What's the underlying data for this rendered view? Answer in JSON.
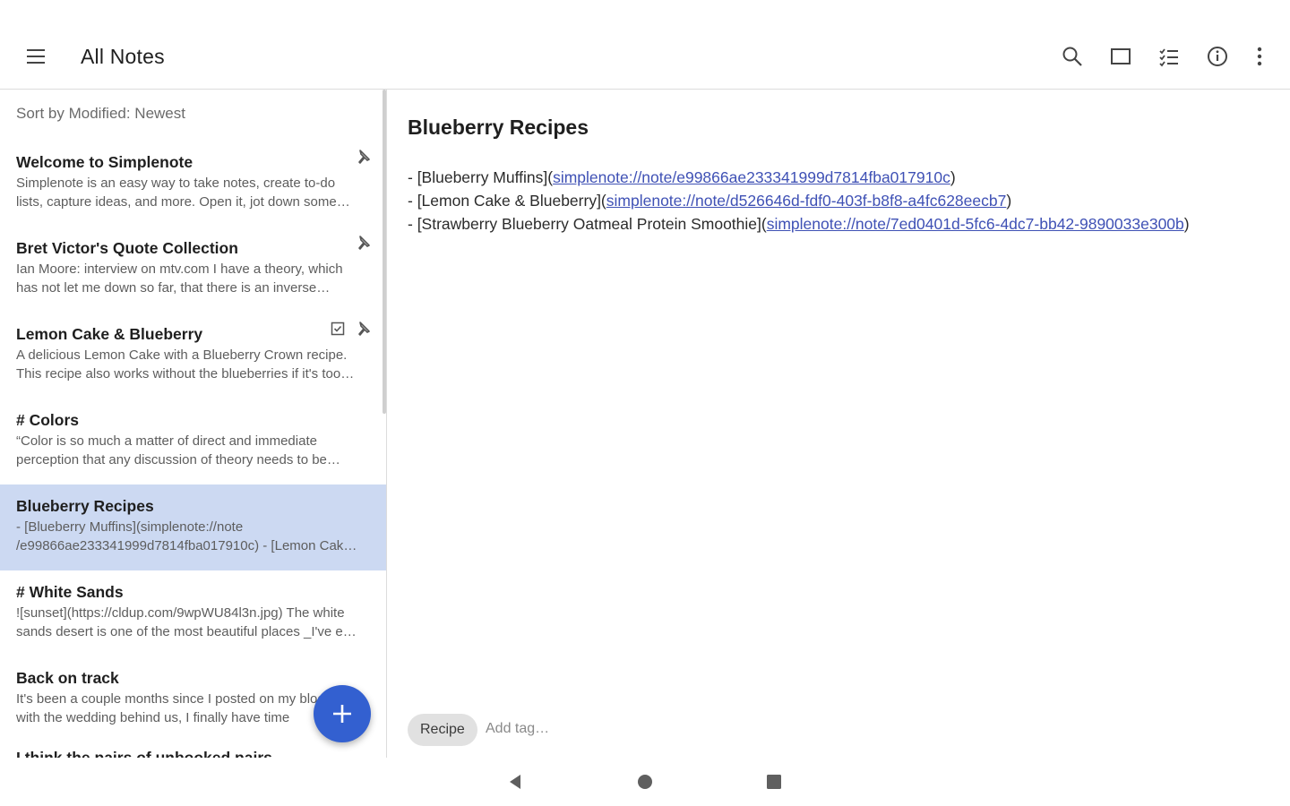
{
  "appbar": {
    "title": "All Notes",
    "icons": [
      "menu-icon",
      "search-icon",
      "sidebar-toggle-icon",
      "checklist-icon",
      "info-icon",
      "more-vert-icon"
    ]
  },
  "list": {
    "sort_prefix": "Sort by ",
    "sort_value": "Modified: Newest",
    "notes": [
      {
        "title": "Welcome to Simplenote",
        "preview": "Simplenote is an easy way to take notes, create to-do lists, capture ideas, and more. Open it, jot down some thoughts, and you're done.",
        "pinned": true,
        "checklist": false
      },
      {
        "title": "Bret Victor's Quote Collection",
        "preview": "Ian Moore: interview on mtv.com I have a theory, which has not let me down so far, that there is an inverse relationship",
        "pinned": true,
        "checklist": false
      },
      {
        "title": "Lemon Cake & Blueberry",
        "preview": "A delicious Lemon Cake with a Blueberry Crown recipe. This recipe also works without the blueberries if it's too much",
        "pinned": true,
        "checklist": true
      },
      {
        "title": "# Colors",
        "preview": "“Color is so much a matter of direct and immediate perception that any discussion of theory needs to be accompanied",
        "pinned": false,
        "checklist": false
      },
      {
        "title": "Blueberry Recipes",
        "preview": "- [Blueberry Muffins](simplenote://note /e99866ae233341999d7814fba017910c) - [Lemon Cake & Blueberry]",
        "pinned": false,
        "checklist": false,
        "selected": true
      },
      {
        "title": "# White Sands",
        "preview": "![sunset](https://cldup.com/9wpWU84l3n.jpg) The white sands desert is one of the most beautiful places _I've ever been",
        "pinned": false,
        "checklist": false
      },
      {
        "title": "Back on track",
        "preview": "It's been a couple months since I posted on my blog. But with the wedding behind us, I finally have time",
        "pinned": false,
        "checklist": false
      }
    ],
    "partial_title": "I think the pairs of unbooked pairs"
  },
  "editor": {
    "title": "Blueberry Recipes",
    "lines": [
      {
        "prefix": "- [Blueberry Muffins](",
        "link": "simplenote://note/e99866ae233341999d7814fba017910c",
        "suffix": ")"
      },
      {
        "prefix": "- [Lemon Cake & Blueberry](",
        "link": "simplenote://note/d526646d-fdf0-403f-b8f8-a4fc628eecb7",
        "suffix": ")"
      },
      {
        "prefix": "- [Strawberry Blueberry Oatmeal Protein Smoothie](",
        "link": "simplenote://note/7ed0401d-5fc6-4dc7-bb42-9890033e300b",
        "suffix": ")"
      }
    ],
    "tag": "Recipe",
    "tag_placeholder": "Add tag…"
  },
  "colors": {
    "accent": "#3360d0",
    "selected_row": "#ccd9f2",
    "link": "#3f51b5"
  },
  "navbar": {
    "icons": [
      "back-icon",
      "home-icon",
      "recents-icon"
    ]
  }
}
